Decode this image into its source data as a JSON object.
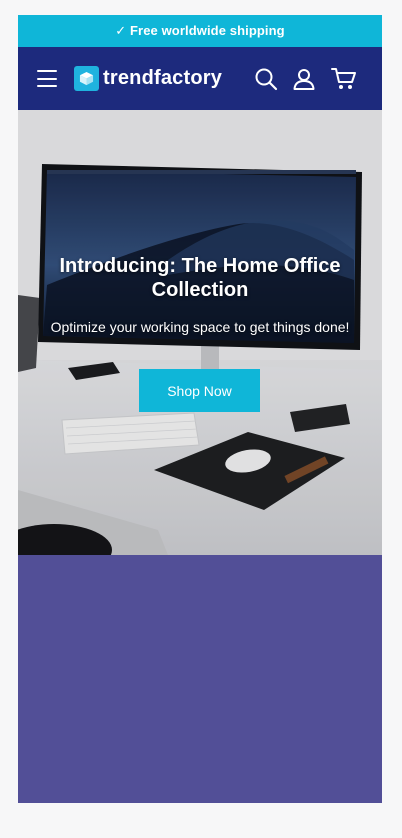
{
  "announcement": {
    "text": "✓ Free worldwide shipping"
  },
  "header": {
    "logo_text": "trendfactory",
    "icons": [
      "menu-icon",
      "search-icon",
      "account-icon",
      "cart-icon"
    ]
  },
  "hero": {
    "title": "Introducing: The Home Office Collection",
    "subtitle": "Optimize your working space to get things done!",
    "cta_label": "Shop Now"
  },
  "colors": {
    "announcement_bg": "#0fb6d8",
    "header_bg": "#1d2a7d",
    "cta_bg": "#0fb6d8",
    "section_bg": "#524f97"
  }
}
